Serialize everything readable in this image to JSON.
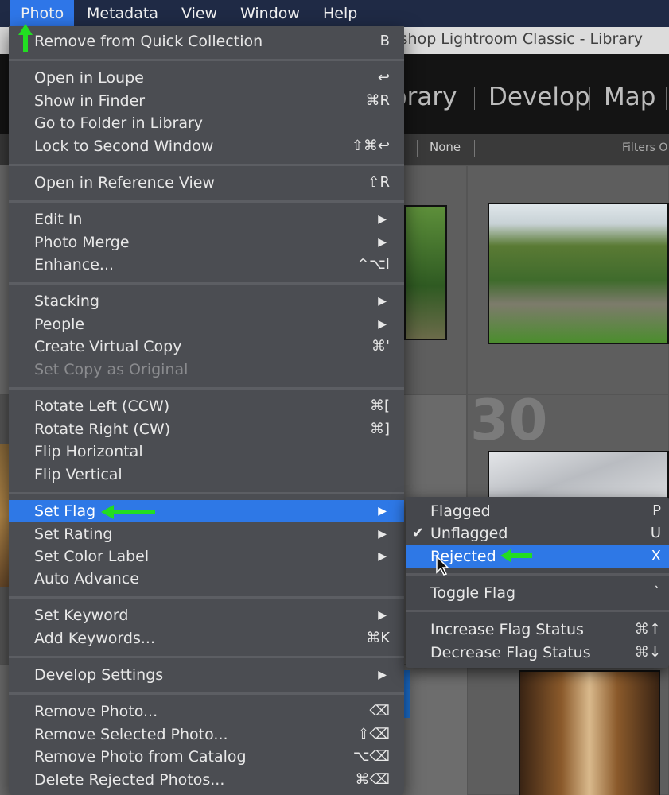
{
  "menubar": {
    "items": [
      {
        "label": "Photo",
        "active": true
      },
      {
        "label": "Metadata"
      },
      {
        "label": "View"
      },
      {
        "label": "Window"
      },
      {
        "label": "Help"
      }
    ]
  },
  "window": {
    "title": "shop Lightroom Classic - Library",
    "modules": [
      "brary",
      "Develop",
      "Map"
    ],
    "filter_none": "None",
    "filters_off": "Filters O",
    "cell_numbers": [
      "30"
    ]
  },
  "photo_menu": {
    "groups": [
      [
        {
          "label": "Remove from Quick Collection",
          "shortcut": "B"
        }
      ],
      [
        {
          "label": "Open in Loupe",
          "shortcut": "↩"
        },
        {
          "label": "Show in Finder",
          "shortcut": "⌘R"
        },
        {
          "label": "Go to Folder in Library",
          "shortcut": ""
        },
        {
          "label": "Lock to Second Window",
          "shortcut": "⇧⌘↩"
        }
      ],
      [
        {
          "label": "Open in Reference View",
          "shortcut": "⇧R"
        }
      ],
      [
        {
          "label": "Edit In",
          "submenu": true
        },
        {
          "label": "Photo Merge",
          "submenu": true
        },
        {
          "label": "Enhance...",
          "shortcut": "^⌥I"
        }
      ],
      [
        {
          "label": "Stacking",
          "submenu": true
        },
        {
          "label": "People",
          "submenu": true
        },
        {
          "label": "Create Virtual Copy",
          "shortcut": "⌘'"
        },
        {
          "label": "Set Copy as Original",
          "disabled": true
        }
      ],
      [
        {
          "label": "Rotate Left (CCW)",
          "shortcut": "⌘["
        },
        {
          "label": "Rotate Right (CW)",
          "shortcut": "⌘]"
        },
        {
          "label": "Flip Horizontal"
        },
        {
          "label": "Flip Vertical"
        }
      ],
      [
        {
          "label": "Set Flag",
          "submenu": true,
          "highlighted": true
        },
        {
          "label": "Set Rating",
          "submenu": true
        },
        {
          "label": "Set Color Label",
          "submenu": true
        },
        {
          "label": "Auto Advance"
        }
      ],
      [
        {
          "label": "Set Keyword",
          "submenu": true
        },
        {
          "label": "Add Keywords...",
          "shortcut": "⌘K"
        }
      ],
      [
        {
          "label": "Develop Settings",
          "submenu": true
        }
      ],
      [
        {
          "label": "Remove Photo...",
          "shortcut": "⌫"
        },
        {
          "label": "Remove Selected Photo...",
          "shortcut": "⇧⌫"
        },
        {
          "label": "Remove Photo from Catalog",
          "shortcut": "⌥⌫"
        },
        {
          "label": "Delete Rejected Photos...",
          "shortcut": "⌘⌫"
        }
      ]
    ]
  },
  "flag_menu": {
    "groups": [
      [
        {
          "label": "Flagged",
          "shortcut": "P"
        },
        {
          "label": "Unflagged",
          "shortcut": "U",
          "checked": true
        },
        {
          "label": "Rejected",
          "shortcut": "X",
          "highlighted": true
        }
      ],
      [
        {
          "label": "Toggle Flag",
          "shortcut": "`"
        }
      ],
      [
        {
          "label": "Increase Flag Status",
          "shortcut": "⌘↑"
        },
        {
          "label": "Decrease Flag Status",
          "shortcut": "⌘↓"
        }
      ]
    ],
    "check_icon": "checkmark-icon"
  },
  "colors": {
    "accent": "#2e78e6",
    "menu_bg": "#4b4d52",
    "arrow": "#22dd22"
  }
}
